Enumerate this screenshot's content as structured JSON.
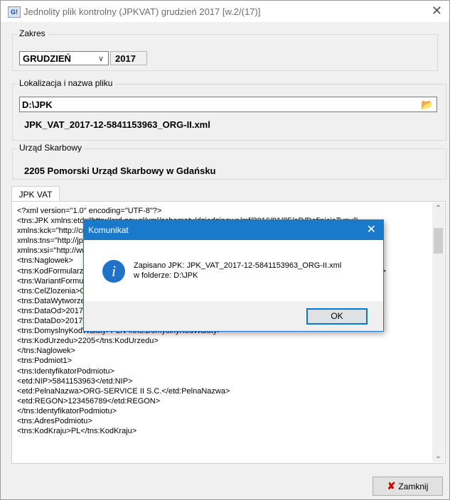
{
  "window": {
    "title": "Jednolity plik kontrolny (JPKVAT) grudzień 2017 [w.2/(17)]",
    "icon_text": "G!",
    "close_glyph": "✕"
  },
  "zakres": {
    "label": "Zakres",
    "month": "GRUDZIEŃ",
    "year": "2017"
  },
  "lokalizacja": {
    "label": "Lokalizacja i nazwa pliku",
    "path": "D:\\JPK",
    "filename": "JPK_VAT_2017-12-5841153963_ORG-II.xml"
  },
  "urzad": {
    "label": "Urząd Skarbowy",
    "value": "2205 Pomorski Urząd Skarbowy w Gdańsku"
  },
  "tab": {
    "label": "JPK VAT"
  },
  "xml_lines": [
    "<?xml version=\"1.0\" encoding=\"UTF-8\"?>",
    "<tns:JPK xmlns:etd=\"http://crd.gov.pl/xml/schematy/dziedzinowe/mf/2016/01/25/eD/DefinicjeTypy/\"",
    "xmlns:kck=\"http://crd.gov.pl/xml/schematy/dziedzinowe/mf/2013/05/23/eD/KodyCECHKRAJOW/\"",
    "xmlns:tns=\"http://jpk.mf.gov.pl/wzor/2017/11/13/1113/\"",
    "xmlns:xsi=\"http://www.w3.org/2001/XMLSchema-instance\">",
    "<tns:Naglowek>",
    "<tns:KodFormularza kodSystemowy=\"JPK_VAT (3)\" wersjaSchemy=\"1-1\">JPK_VAT</tns:KodFormularza>",
    "<tns:WariantFormularza>3</tns:WariantFormularza>",
    "<tns:CelZlozenia>0</tns:CelZlozenia>",
    "<tns:DataWytworzeniaJPK>2018-01-19T10:12:44</tns:DataWytworzeniaJPK>",
    "<tns:DataOd>2017-12-01</tns:DataOd>",
    "<tns:DataDo>2017-12-31</tns:DataDo>",
    "<tns:DomyslnyKodWaluty>PLN</tns:DomyslnyKodWaluty>",
    "<tns:KodUrzedu>2205</tns:KodUrzedu>",
    "</tns:Naglowek>",
    "<tns:Podmiot1>",
    "<tns:IdentyfikatorPodmiotu>",
    "<etd:NIP>5841153963</etd:NIP>",
    "<etd:PelnaNazwa>ORG-SERVICE II S.C.</etd:PelnaNazwa>",
    "<etd:REGON>123456789</etd:REGON>",
    "</tns:IdentyfikatorPodmiotu>",
    "<tns:AdresPodmiotu>",
    "<tns:KodKraju>PL</tns:KodKraju>"
  ],
  "buttons": {
    "close_label": "Zamknij",
    "close_glyph": "✘"
  },
  "dialog": {
    "title": "Komunikat",
    "close_glyph": "✕",
    "icon_glyph": "i",
    "message_line1": "Zapisano JPK: JPK_VAT_2017-12-5841153963_ORG-II.xml",
    "message_line2": "w folderze: D:\\JPK",
    "ok_label": "OK"
  }
}
